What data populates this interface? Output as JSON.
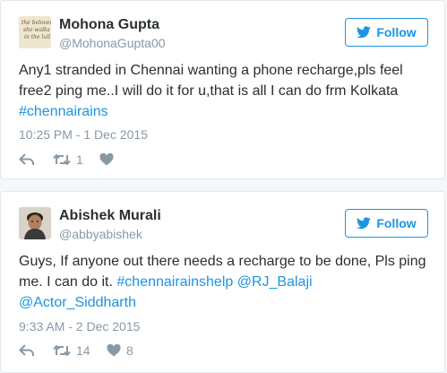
{
  "tweets": [
    {
      "name": "Mohona Gupta",
      "handle": "@MohonaGupta00",
      "follow_label": "Follow",
      "text_plain": "Any1 stranded in Chennai wanting a phone recharge,pls feel free2 ping me..I will do it for u,that is all I can do frm Kolkata ",
      "hashtag": "#chennairains",
      "timestamp": "10:25 PM - 1 Dec 2015",
      "retweets": "1",
      "likes": "",
      "avatar_text": "the beloved she walks in the lull"
    },
    {
      "name": "Abishek Murali",
      "handle": "@abbyabishek",
      "follow_label": "Follow",
      "text_plain": "Guys, If anyone out there needs a recharge to be done, Pls ping me. I can do it. ",
      "hashtag": "#chennairainshelp",
      "mention1": "@RJ_Balaji",
      "mention2": "@Actor_Siddharth",
      "timestamp": "9:33 AM - 2 Dec 2015",
      "retweets": "14",
      "likes": "8"
    }
  ],
  "colors": {
    "link": "#1b95e0",
    "text": "#292f33",
    "muted": "#8899a6",
    "border": "#e1e8ed",
    "background": "#f5f8fa"
  },
  "icons": [
    "twitter-bird-icon",
    "reply-icon",
    "retweet-icon",
    "like-icon"
  ]
}
